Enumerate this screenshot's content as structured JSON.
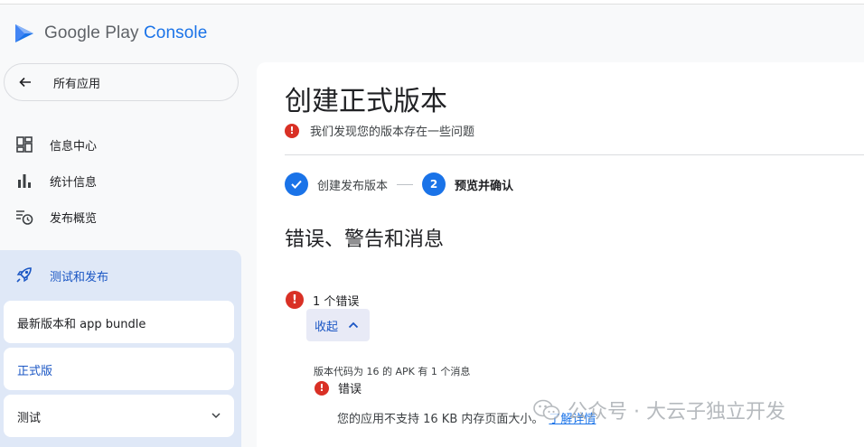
{
  "brand": {
    "name_main": "Google Play",
    "name_accent": " Console",
    "accent": "#1a73e8"
  },
  "sidebar": {
    "back_label": "所有应用",
    "items": [
      {
        "label": "信息中心",
        "icon": "dashboard-icon"
      },
      {
        "label": "统计信息",
        "icon": "bar-chart-icon"
      },
      {
        "label": "发布概览",
        "icon": "publishing-overview-icon"
      }
    ],
    "section": {
      "label": "测试和发布",
      "icon": "rocket-icon",
      "subitems": [
        {
          "label": "最新版本和 app bundle"
        },
        {
          "label": "正式版",
          "active": true
        },
        {
          "label": "测试",
          "expandable": true
        }
      ]
    }
  },
  "main": {
    "title": "创建正式版本",
    "issue_summary": "我们发现您的版本存在一些问题",
    "steps": [
      {
        "label": "创建发布版本",
        "state": "done"
      },
      {
        "number": "2",
        "label": "预览并确认",
        "state": "current"
      }
    ],
    "section_title": "错误、警告和消息",
    "error_count": "1 个错误",
    "collapse_label": "收起",
    "detail": {
      "heading": "版本代码为 16 的 APK 有 1 个消息",
      "type": "错误",
      "message": "您的应用不支持 16 KB 内存页面大小。",
      "link": "了解详情"
    },
    "error_color": "#d93025"
  },
  "watermark": {
    "text": "公众号 · 大云子独立开发"
  }
}
